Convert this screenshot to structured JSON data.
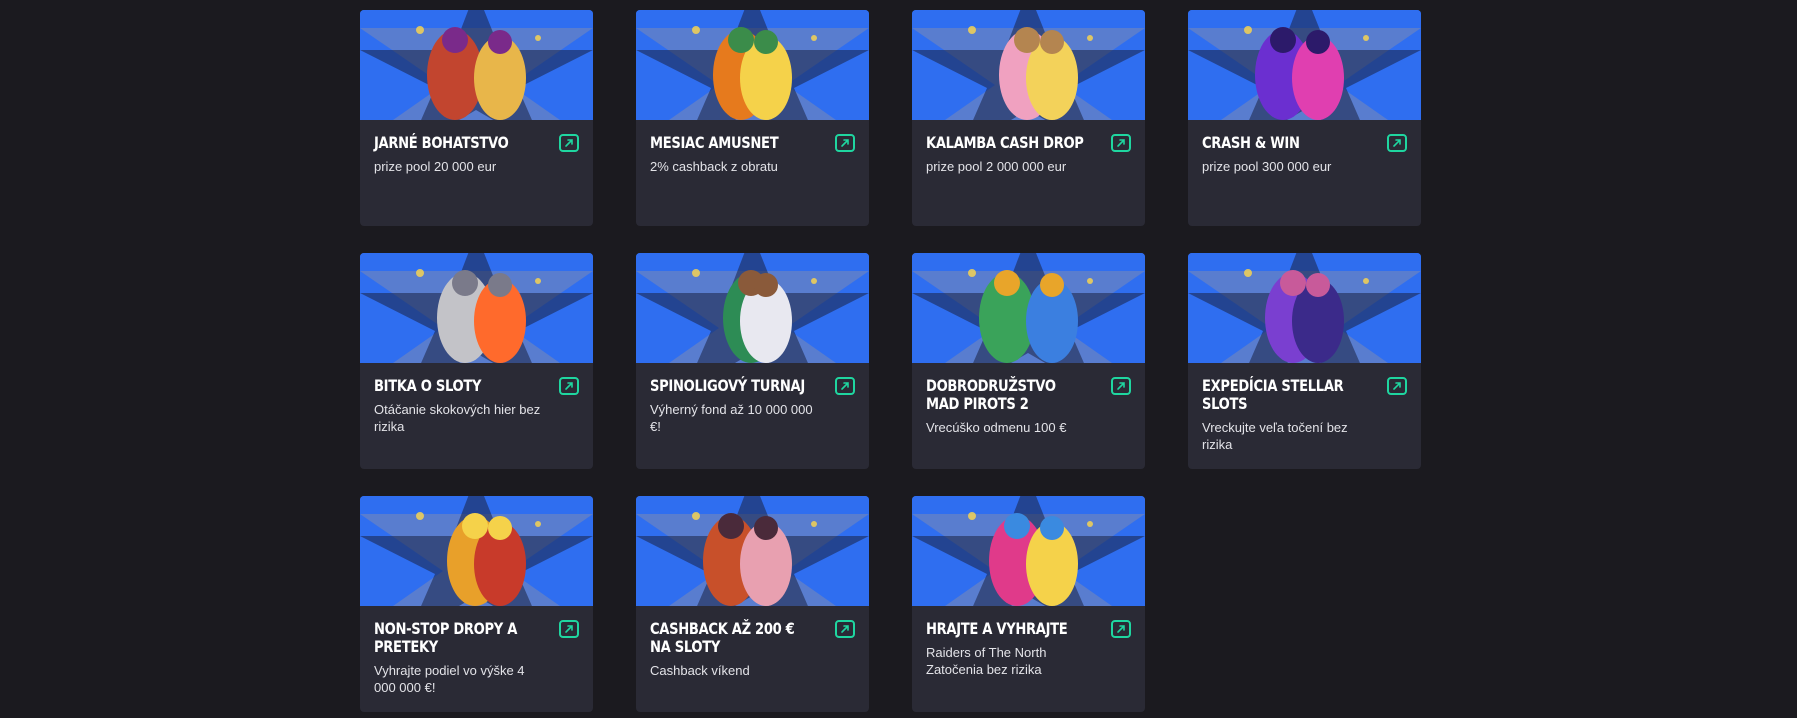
{
  "colors": {
    "page_bg": "#1b1a1f",
    "card_bg": "#2a2a35",
    "banner_blue": "#2f6ef0",
    "accent_green": "#1fd6a0"
  },
  "cards": [
    {
      "title": "JARNÉ BOHATSTVO",
      "desc": "prize pool 20 000 eur",
      "icon": "external-link-icon"
    },
    {
      "title": "MESIAC AMUSNET",
      "desc": "2% cashback z obratu",
      "icon": "external-link-icon"
    },
    {
      "title": "KALAMBA CASH DROP",
      "desc": "prize pool 2 000 000 eur",
      "icon": "external-link-icon"
    },
    {
      "title": "CRASH & WIN",
      "desc": "prize pool 300 000 eur",
      "icon": "external-link-icon"
    },
    {
      "title": "BITKA O SLOTY",
      "desc": "Otáčanie skokových hier bez rizika",
      "icon": "external-link-icon"
    },
    {
      "title": "SPINOLIGOVÝ TURNAJ",
      "desc": "Výherný fond až 10 000 000 €!",
      "icon": "external-link-icon"
    },
    {
      "title": "DOBRODRUŽSTVO MAD PIROTS 2",
      "desc": "Vrecúško odmenu 100 €",
      "icon": "external-link-icon"
    },
    {
      "title": "EXPEDÍCIA STELLAR SLOTS",
      "desc": "Vreckujte veľa točení bez rizika",
      "icon": "external-link-icon"
    },
    {
      "title": "NON-STOP DROPY A PRETEKY",
      "desc": "Vyhrajte podiel vo výške 4 000 000 €!",
      "icon": "external-link-icon"
    },
    {
      "title": "CASHBACK AŽ 200 € NA SLOTY",
      "desc": "Cashback víkend",
      "icon": "external-link-icon"
    },
    {
      "title": "HRAJTE A VYHRAJTE",
      "desc": "Raiders of The North Zatočenia bez rizika",
      "icon": "external-link-icon"
    }
  ]
}
